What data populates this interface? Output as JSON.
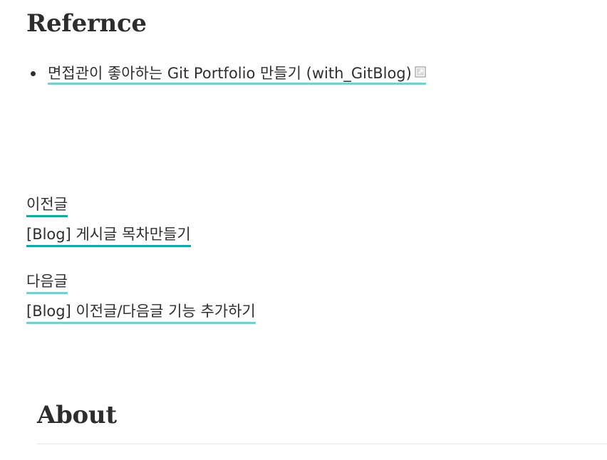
{
  "reference": {
    "heading": "Refernce",
    "items": [
      {
        "label": "면접관이 좋아하는 Git Portfolio 만들기 (with_GitBlog)",
        "icon": "external-link-icon"
      }
    ]
  },
  "post_nav": {
    "previous": {
      "label": "이전글",
      "title": "[Blog] 게시글 목차만들기"
    },
    "next": {
      "label": "다음글",
      "title": "[Blog] 이전글/다음글 기능 추가하기"
    }
  },
  "about": {
    "heading": "About"
  },
  "colors": {
    "accent": "#1ba3a8",
    "accent_light": "#7ccdd3",
    "text": "#2f2f2f",
    "divider": "#e6e6e6"
  }
}
